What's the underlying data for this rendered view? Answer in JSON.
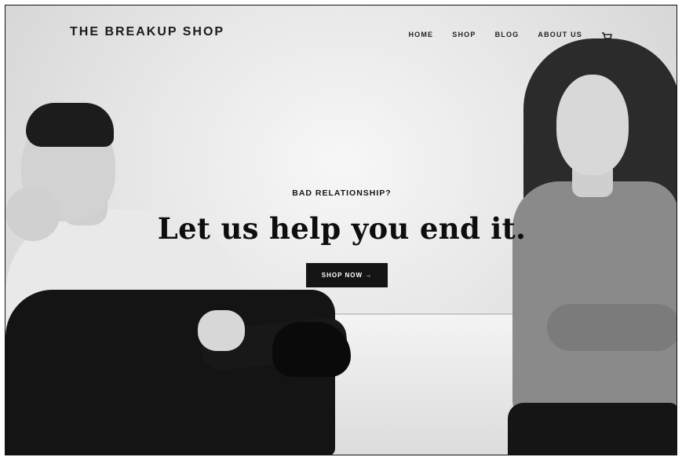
{
  "header": {
    "brand": "THE BREAKUP SHOP",
    "nav": [
      {
        "label": "HOME"
      },
      {
        "label": "SHOP"
      },
      {
        "label": "BLOG"
      },
      {
        "label": "ABOUT US"
      }
    ],
    "cart_icon": "cart-icon"
  },
  "hero": {
    "tagline": "BAD RELATIONSHIP?",
    "headline": "Let us help you end it.",
    "cta_label": "SHOP NOW →"
  },
  "colors": {
    "text_dark": "#111111",
    "button_bg": "#141414",
    "button_text": "#ffffff"
  }
}
